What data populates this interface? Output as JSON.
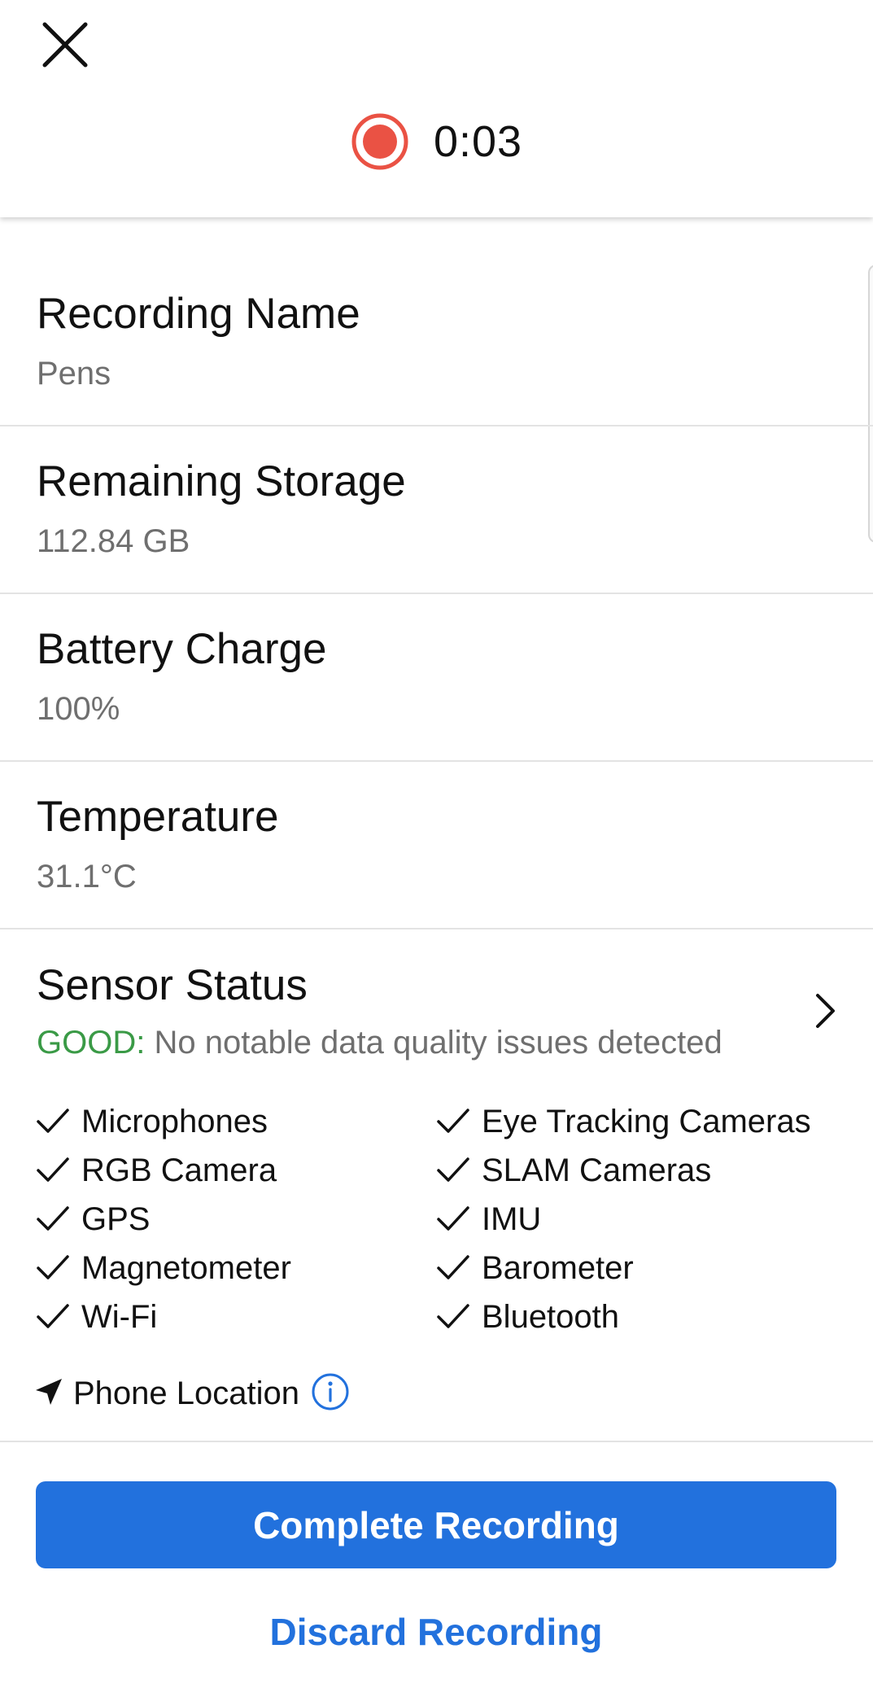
{
  "header": {
    "close_icon": "close-icon",
    "recording_icon": "record-icon",
    "recording_color": "#ea5244",
    "elapsed_time": "0:03"
  },
  "info": {
    "recording_name": {
      "title": "Recording Name",
      "value": "Pens"
    },
    "remaining_storage": {
      "title": "Remaining Storage",
      "value": "112.84 GB"
    },
    "battery_charge": {
      "title": "Battery Charge",
      "value": "100%"
    },
    "temperature": {
      "title": "Temperature",
      "value": "31.1°C"
    }
  },
  "sensor_status": {
    "title": "Sensor Status",
    "status_label": "GOOD:",
    "status_message": " No notable data quality issues detected",
    "status_color": "#3a9a46",
    "chevron_icon": "chevron-right-icon",
    "sensors_left": [
      "Microphones",
      "RGB Camera",
      "GPS",
      "Magnetometer",
      "Wi-Fi"
    ],
    "sensors_right": [
      "Eye Tracking Cameras",
      "SLAM Cameras",
      "IMU",
      "Barometer",
      "Bluetooth"
    ],
    "check_icon": "check-icon",
    "phone_location": {
      "label": "Phone Location",
      "location_icon": "location-arrow-icon",
      "info_icon": "info-icon"
    }
  },
  "actions": {
    "complete_label": "Complete Recording",
    "discard_label": "Discard Recording",
    "accent_color": "#2271dd"
  }
}
